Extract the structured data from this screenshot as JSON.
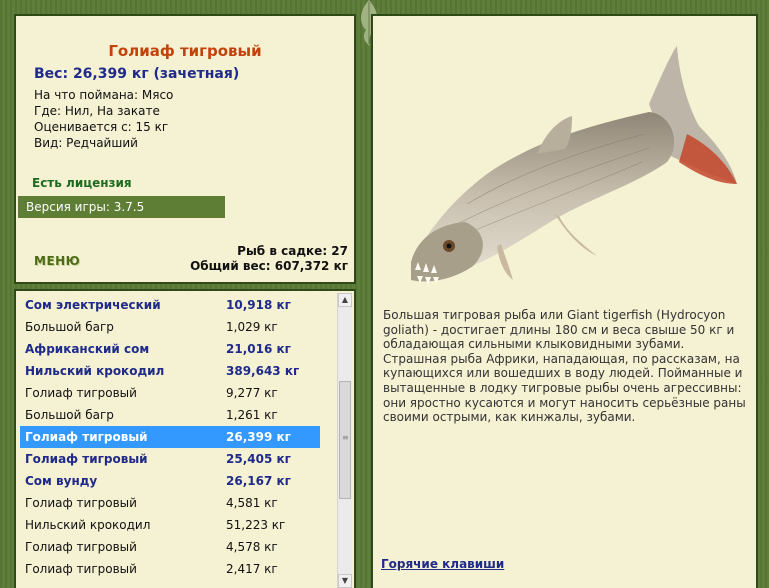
{
  "fish_card": {
    "title": "Голиаф тигровый",
    "weight": "Вес: 26,399 кг (зачетная)",
    "bait": "На что поймана: Мясо",
    "place": "Где: Нил, На закате",
    "value": "Оценивается с:  15 кг",
    "kind": "Вид: Редчайший"
  },
  "license": "Есть лицензия",
  "version": "Версия игры: 3.7.5",
  "menu_label": "МЕНЮ",
  "cage_count": "Рыб в садке: 27",
  "total_weight": "Общий вес: 607,372 кг",
  "catch_list": [
    {
      "name": "Сом электрический",
      "weight": "10,918 кг",
      "style": "bold"
    },
    {
      "name": "Большой багр",
      "weight": "1,029 кг",
      "style": "normal"
    },
    {
      "name": "Африканский сом",
      "weight": "21,016 кг",
      "style": "bold"
    },
    {
      "name": "Нильский крокодил",
      "weight": "389,643 кг",
      "style": "bold"
    },
    {
      "name": "Голиаф тигровый",
      "weight": "9,277 кг",
      "style": "normal"
    },
    {
      "name": "Большой багр",
      "weight": "1,261 кг",
      "style": "normal"
    },
    {
      "name": "Голиаф тигровый",
      "weight": "26,399 кг",
      "style": "selected"
    },
    {
      "name": "Голиаф тигровый",
      "weight": "25,405 кг",
      "style": "bold"
    },
    {
      "name": "Сом вунду",
      "weight": "26,167 кг",
      "style": "bold"
    },
    {
      "name": "Голиаф тигровый",
      "weight": "4,581 кг",
      "style": "normal"
    },
    {
      "name": "Нильский крокодил",
      "weight": "51,223 кг",
      "style": "normal"
    },
    {
      "name": "Голиаф тигровый",
      "weight": "4,578 кг",
      "style": "normal"
    },
    {
      "name": "Голиаф тигровый",
      "weight": "2,417 кг",
      "style": "normal"
    }
  ],
  "description": "Большая тигровая рыба или Giant tigerfish (Hydrocyon goliath) - достигает длины 180 см и веса свыше 50 кг и обладающая сильными клыковидными зубами. Страшная рыба Африки, нападающая, по рассказам, на купающихся или вошедших в воду людей. Пойманные и вытащенные в лодку тигровые рыбы очень агрессивны: они яростно кусаются и могут наносить серьёзные раны своими острыми, как кинжалы, зубами.",
  "hotkeys": "Горячие клавиши",
  "icons": {
    "scroll_up": "up-arrow-icon",
    "scroll_down": "down-arrow-icon",
    "leaf": "leaf-icon"
  },
  "colors": {
    "title": "#c2420a",
    "accent_blue": "#1f2a8a",
    "selection": "#3399ff",
    "frame": "#5a7a36",
    "panel": "#f5f1d3"
  }
}
